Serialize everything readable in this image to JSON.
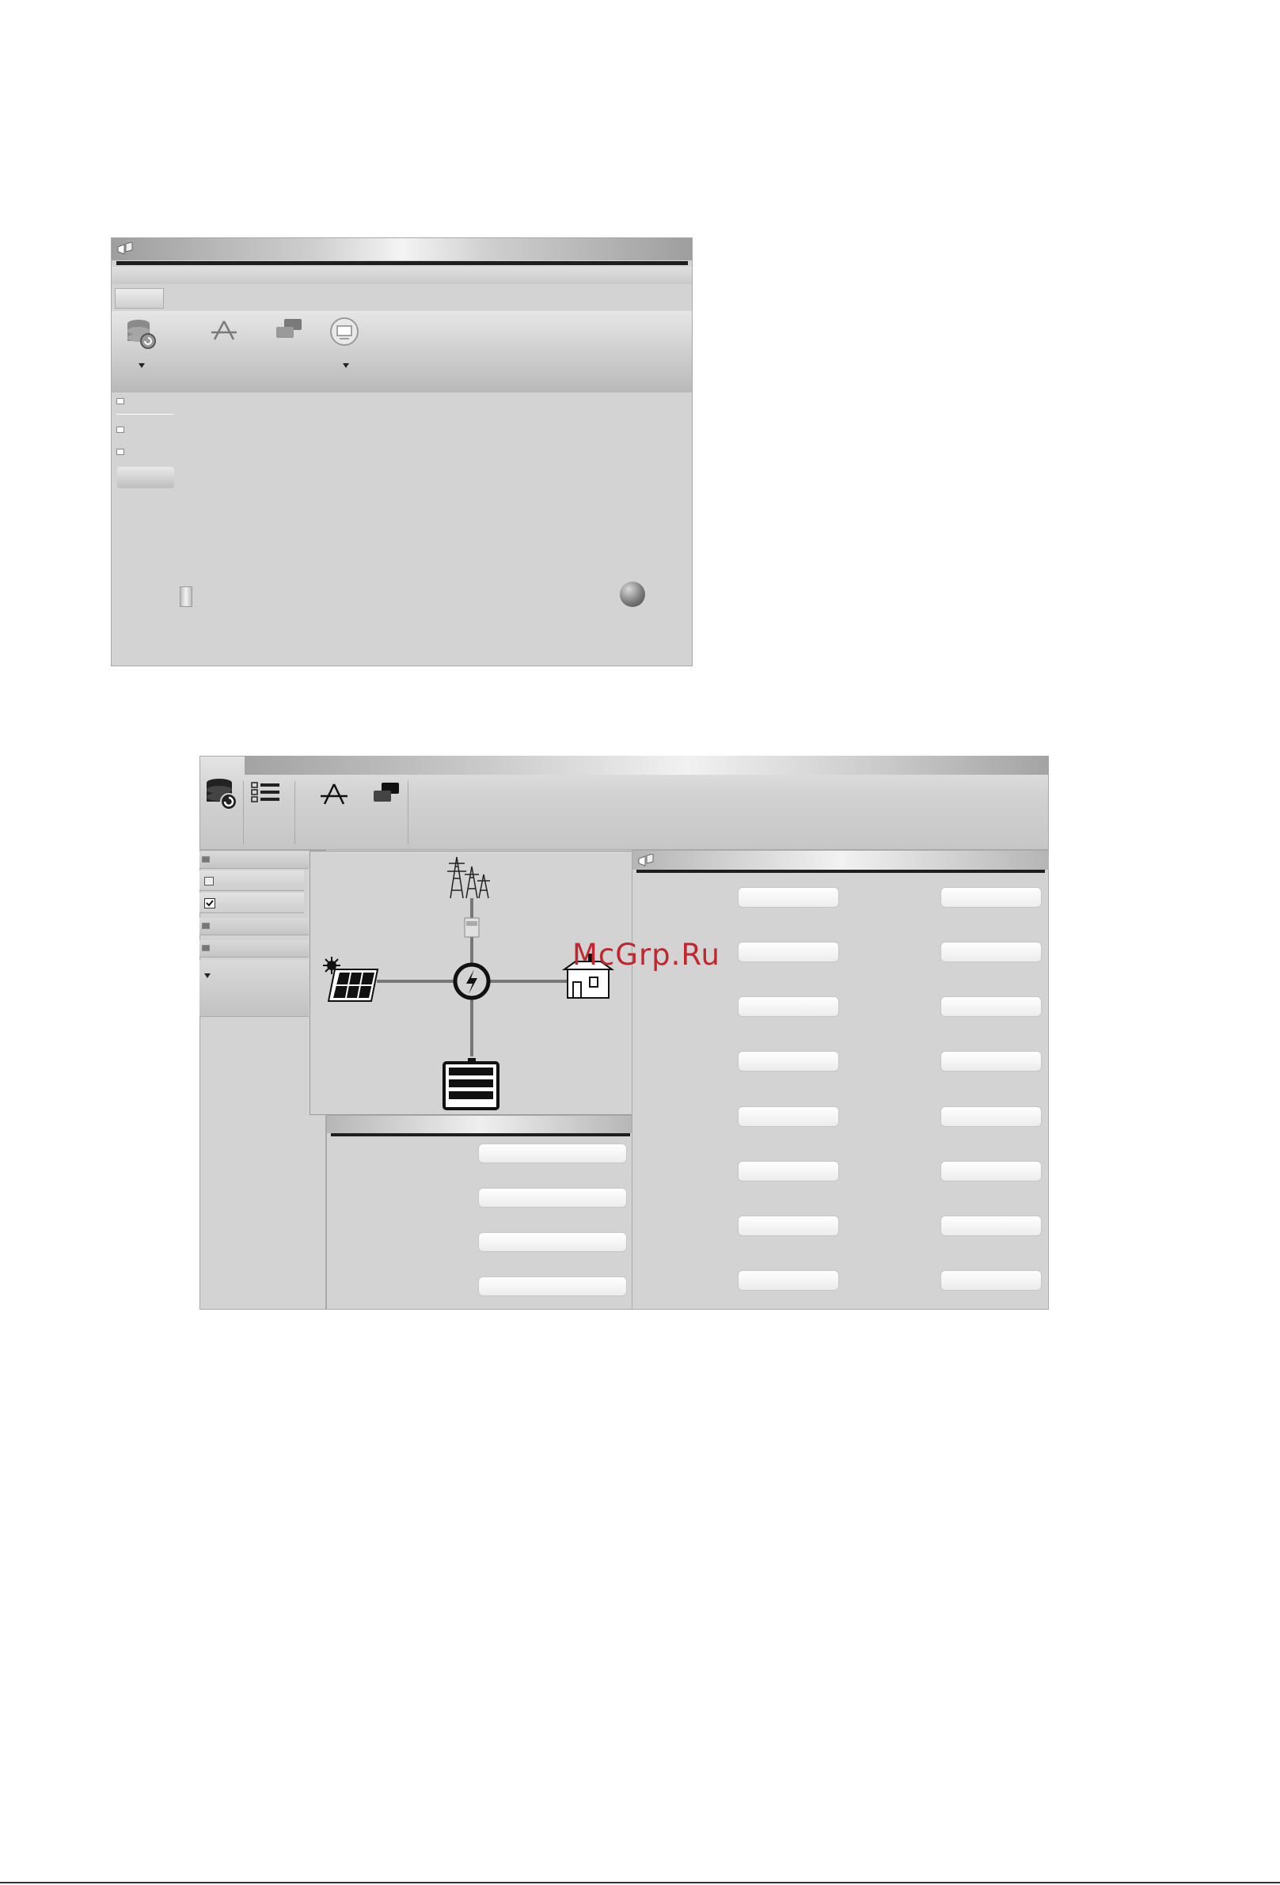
{
  "watermark": {
    "text": "McGrp.Ru",
    "color": "#c0262d"
  },
  "window1": {
    "icons": [
      "logo-icon",
      "database-restore-icon",
      "compass-icon",
      "stacked-windows-icon",
      "monitor-circle-icon",
      "chevron-down-icon",
      "sphere-icon"
    ]
  },
  "window2": {
    "icons": [
      "database-restore-icon",
      "checklist-icon",
      "compass-icon",
      "stacked-windows-icon",
      "logo-icon"
    ],
    "diagram_nodes": [
      "grid-tower-icon",
      "meter-icon",
      "inverter-icon",
      "solar-panel-icon",
      "house-icon",
      "battery-icon"
    ]
  }
}
